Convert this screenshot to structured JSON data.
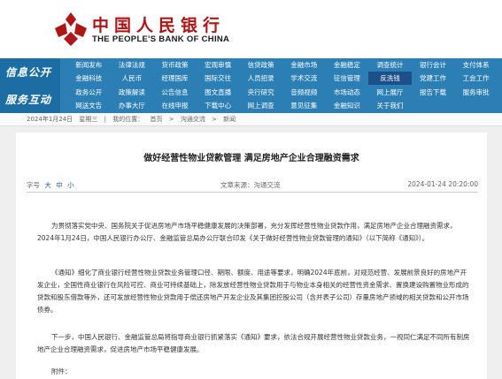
{
  "header": {
    "logo_cn": "中国人民银行",
    "logo_en": "THE PEOPLE'S BANK OF CHINA"
  },
  "nav": {
    "info_section": "信息公开",
    "service_section": "服务互动",
    "rows": [
      [
        "新闻发布",
        "法律法规",
        "货币政策",
        "宏观审慎",
        "信贷政策",
        "金融市场",
        "金融稳定",
        "调查统计",
        "银行会计",
        "支付体系"
      ],
      [
        "金融科技",
        "人民币",
        "经理国库",
        "国际交往",
        "人员招录",
        "学术交流",
        "征信管理",
        "反洗钱",
        "党建工作",
        "工会工作"
      ],
      [
        "政务公开",
        "政策解读",
        "公告信息",
        "图文直播",
        "央行研究",
        "音频视频",
        "市场动态",
        "网上展厅",
        "报告下载",
        "服务审批"
      ],
      [
        "网送文告",
        "办事大厅",
        "在线申报",
        "下载中心",
        "网上调查",
        "意见征集",
        "金融知识",
        "关于我们",
        "",
        ""
      ]
    ],
    "highlighted": [
      [
        1,
        7
      ]
    ]
  },
  "breadcrumb": {
    "date": "2024年1月24日",
    "weekday": "星期三",
    "location_label": "我的位置：",
    "items": [
      "首页",
      "沟通交流",
      "新闻"
    ]
  },
  "article": {
    "title": "做好经营性物业贷款管理 满足房地产企业合理融资需求",
    "font_size_label": "字号",
    "font_sizes": [
      "大",
      "中",
      "小"
    ],
    "source_label": "文章来源：",
    "source": "沟通交流",
    "datetime": "2024-01-24 20:20:00",
    "p1": "为贯彻落实党中央、国务院关于促进房地产市场平稳健康发展的决策部署，充分发挥经营性物业贷款作用，满足房地产企业合理融资需求，2024年1月24日，中国人民银行办公厅、金融监管总局办公厅联合印发《关于做好经营性物业贷款管理的通知》（以下简称《通知》）。",
    "p2": "《通知》细化了商业银行经营性物业贷款业务管理口径、期限、额度、用途等要求，明确2024年底前，对规范经营、发展前景良好的房地产开发企业，全国性商业银行在风险可控、商业可持续基础上，除发放经营性物业贷款用于与物业本身相关的经营性资金需求、置换建设购置物业形成的贷款和股东借款等外，还可发放经营性物业贷款用于偿还房地产开发企业及其集团控股公司（含并表子公司）存量房地产领域的相关贷款和公开市场债券。",
    "p3": "下一步，中国人民银行、金融监管总局将指导商业银行抓紧落实《通知》要求，依法合规开展经营性物业贷款业务，一视同仁满足不同所有制房地产企业合理融资需求，促进房地产市场平稳健康发展。",
    "p4": "附件："
  },
  "colors": {
    "brand_red": "#b01515",
    "nav_blue": "#2b7fb5",
    "nav_dark": "#1c6da3",
    "link_blue": "#1d5aa8"
  }
}
